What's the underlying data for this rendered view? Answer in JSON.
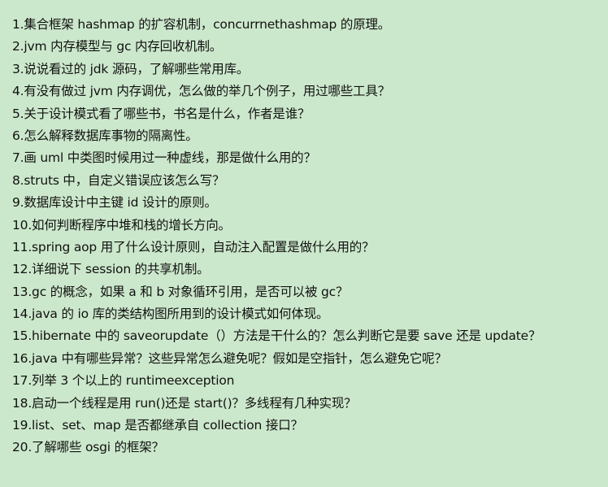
{
  "lines": [
    "1.集合框架 hashmap 的扩容机制，concurrnethashmap 的原理。",
    "2.jvm 内存模型与 gc 内存回收机制。",
    "3.说说看过的 jdk 源码，了解哪些常用库。",
    "4.有没有做过 jvm 内存调优，怎么做的举几个例子，用过哪些工具？",
    "5.关于设计模式看了哪些书，书名是什么，作者是谁？",
    "6.怎么解释数据库事物的隔离性。",
    "7.画 uml 中类图时候用过一种虚线，那是做什么用的？",
    "8.struts 中，自定义错误应该怎么写？",
    "9.数据库设计中主键 id 设计的原则。",
    "10.如何判断程序中堆和栈的增长方向。",
    "11.spring aop 用了什么设计原则，自动注入配置是做什么用的？",
    "12.详细说下 session 的共享机制。",
    "13.gc 的概念，如果 a 和 b 对象循环引用，是否可以被 gc？",
    "14.java 的 io 库的类结构图所用到的设计模式如何体现。",
    "15.hibernate 中的 saveorupdate（）方法是干什么的？怎么判断它是要 save 还是 update？",
    "16.java 中有哪些异常？这些异常怎么避免呢？假如是空指针，怎么避免它呢？",
    "17.列举 3 个以上的 runtimeexception",
    "18.启动一个线程是用 run()还是 start()？多线程有几种实现？",
    "19.list、set、map 是否都继承自 collection 接口？",
    "20.了解哪些 osgi 的框架？"
  ],
  "colors": {
    "background": "#cce8cc",
    "text": "#111111"
  }
}
